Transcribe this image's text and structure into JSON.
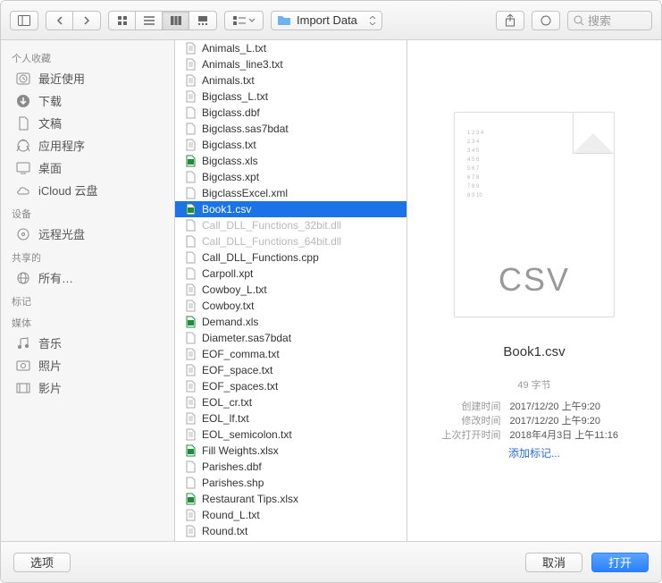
{
  "toolbar": {
    "folder_name": "Import Data",
    "search_label": "搜索"
  },
  "sidebar": {
    "sections": [
      {
        "title": "个人收藏",
        "items": [
          {
            "icon": "clock",
            "label": "最近使用"
          },
          {
            "icon": "download",
            "label": "下载"
          },
          {
            "icon": "doc",
            "label": "文稿"
          },
          {
            "icon": "app",
            "label": "应用程序"
          },
          {
            "icon": "desktop",
            "label": "桌面"
          },
          {
            "icon": "cloud",
            "label": "iCloud 云盘"
          }
        ]
      },
      {
        "title": "设备",
        "items": [
          {
            "icon": "disc",
            "label": "远程光盘"
          }
        ]
      },
      {
        "title": "共享的",
        "items": [
          {
            "icon": "globe",
            "label": "所有…"
          }
        ]
      },
      {
        "title": "标记",
        "items": []
      },
      {
        "title": "媒体",
        "items": [
          {
            "icon": "music",
            "label": "音乐"
          },
          {
            "icon": "photo",
            "label": "照片"
          },
          {
            "icon": "movie",
            "label": "影片"
          }
        ]
      }
    ]
  },
  "files": [
    {
      "name": "Animals_L.txt",
      "type": "txt"
    },
    {
      "name": "Animals_line3.txt",
      "type": "txt"
    },
    {
      "name": "Animals.txt",
      "type": "txt"
    },
    {
      "name": "Bigclass_L.txt",
      "type": "txt"
    },
    {
      "name": "Bigclass.dbf",
      "type": "gen"
    },
    {
      "name": "Bigclass.sas7bdat",
      "type": "gen"
    },
    {
      "name": "Bigclass.txt",
      "type": "txt"
    },
    {
      "name": "Bigclass.xls",
      "type": "xls"
    },
    {
      "name": "Bigclass.xpt",
      "type": "gen"
    },
    {
      "name": "BigclassExcel.xml",
      "type": "gen"
    },
    {
      "name": "Book1.csv",
      "type": "xls",
      "selected": true
    },
    {
      "name": "Call_DLL_Functions_32bit.dll",
      "type": "gen",
      "disabled": true
    },
    {
      "name": "Call_DLL_Functions_64bit.dll",
      "type": "gen",
      "disabled": true
    },
    {
      "name": "Call_DLL_Functions.cpp",
      "type": "gen"
    },
    {
      "name": "Carpoll.xpt",
      "type": "gen"
    },
    {
      "name": "Cowboy_L.txt",
      "type": "txt"
    },
    {
      "name": "Cowboy.txt",
      "type": "txt"
    },
    {
      "name": "Demand.xls",
      "type": "xls"
    },
    {
      "name": "Diameter.sas7bdat",
      "type": "gen"
    },
    {
      "name": "EOF_comma.txt",
      "type": "txt"
    },
    {
      "name": "EOF_space.txt",
      "type": "txt"
    },
    {
      "name": "EOF_spaces.txt",
      "type": "txt"
    },
    {
      "name": "EOL_cr.txt",
      "type": "txt"
    },
    {
      "name": "EOL_lf.txt",
      "type": "txt"
    },
    {
      "name": "EOL_semicolon.txt",
      "type": "txt"
    },
    {
      "name": "Fill Weights.xlsx",
      "type": "xls"
    },
    {
      "name": "Parishes.dbf",
      "type": "gen"
    },
    {
      "name": "Parishes.shp",
      "type": "gen"
    },
    {
      "name": "Restaurant Tips.xlsx",
      "type": "xls"
    },
    {
      "name": "Round_L.txt",
      "type": "txt"
    },
    {
      "name": "Round.txt",
      "type": "txt"
    }
  ],
  "preview": {
    "badge": "CSV",
    "filename": "Book1.csv",
    "filesize": "49 字节",
    "meta": [
      {
        "label": "创建时间",
        "value": "2017/12/20 上午9:20"
      },
      {
        "label": "修改时间",
        "value": "2017/12/20 上午9:20"
      },
      {
        "label": "上次打开时间",
        "value": "2018年4月3日 上午11:16"
      }
    ],
    "add_tag": "添加标记..."
  },
  "footer": {
    "options": "选项",
    "cancel": "取消",
    "open": "打开"
  }
}
